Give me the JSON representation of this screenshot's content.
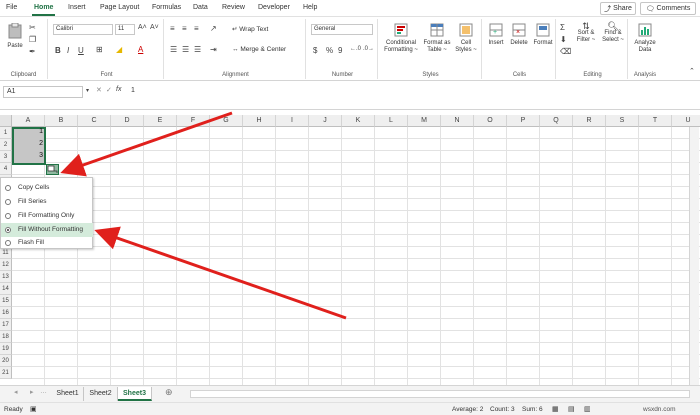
{
  "tabs": [
    "File",
    "Home",
    "Insert",
    "Page Layout",
    "Formulas",
    "Data",
    "Review",
    "Developer",
    "Help"
  ],
  "active_tab": "Home",
  "share_label": "Share",
  "comments_label": "Comments",
  "ribbon": {
    "clipboard": {
      "label": "Clipboard",
      "paste": "Paste"
    },
    "font": {
      "label": "Font",
      "font_name": "Calibri",
      "font_size": "11",
      "bold": "B",
      "italic": "I",
      "underline": "U",
      "grow": "A˄",
      "shrink": "A˅",
      "font_color": "A"
    },
    "alignment": {
      "label": "Alignment",
      "wrap_text": "Wrap Text",
      "merge_center": "Merge & Center"
    },
    "number": {
      "label": "Number",
      "format": "General",
      "currency": "$",
      "percent": "%",
      "comma": "9"
    },
    "styles": {
      "label": "Styles",
      "conditional_1": "Conditional",
      "conditional_2": "Formatting ~",
      "format_as_1": "Format as",
      "format_as_2": "Table ~",
      "cell_styles_1": "Cell",
      "cell_styles_2": "Styles ~"
    },
    "cells": {
      "label": "Cells",
      "insert": "Insert",
      "delete": "Delete",
      "format": "Format"
    },
    "editing": {
      "label": "Editing",
      "sort_1": "Sort &",
      "sort_2": "Filter ~",
      "find_1": "Find &",
      "find_2": "Select ~"
    },
    "analysis": {
      "label": "Analysis",
      "analyze_1": "Analyze",
      "analyze_2": "Data"
    }
  },
  "formula_bar": {
    "name_box": "A1",
    "value": "1",
    "fx": "fx"
  },
  "columns": [
    "A",
    "B",
    "C",
    "D",
    "E",
    "F",
    "G",
    "H",
    "I",
    "J",
    "K",
    "L",
    "M",
    "N",
    "O",
    "P",
    "Q",
    "R",
    "S",
    "T",
    "U"
  ],
  "rows": [
    "1",
    "2",
    "3",
    "4",
    "5",
    "6",
    "7",
    "8",
    "9",
    "10",
    "11",
    "12",
    "13",
    "14",
    "15",
    "16",
    "17",
    "18",
    "19",
    "20",
    "21"
  ],
  "cells": {
    "A1": "1",
    "A2": "2",
    "A3": "3"
  },
  "autofill_menu": [
    {
      "label": "Copy Cells",
      "selected": false
    },
    {
      "label": "Fill Series",
      "selected": false
    },
    {
      "label": "Fill Formatting Only",
      "selected": false
    },
    {
      "label": "Fill Without Formatting",
      "selected": true
    },
    {
      "label": "Flash Fill",
      "selected": false
    }
  ],
  "sheets": [
    "Sheet1",
    "Sheet2",
    "Sheet3"
  ],
  "active_sheet": "Sheet3",
  "status": {
    "ready": "Ready",
    "average": "Average: 2",
    "count": "Count: 3",
    "sum": "Sum: 6"
  },
  "watermark": "wsxdn.com",
  "colors": {
    "accent": "#217346",
    "arrow": "#e0201c"
  }
}
